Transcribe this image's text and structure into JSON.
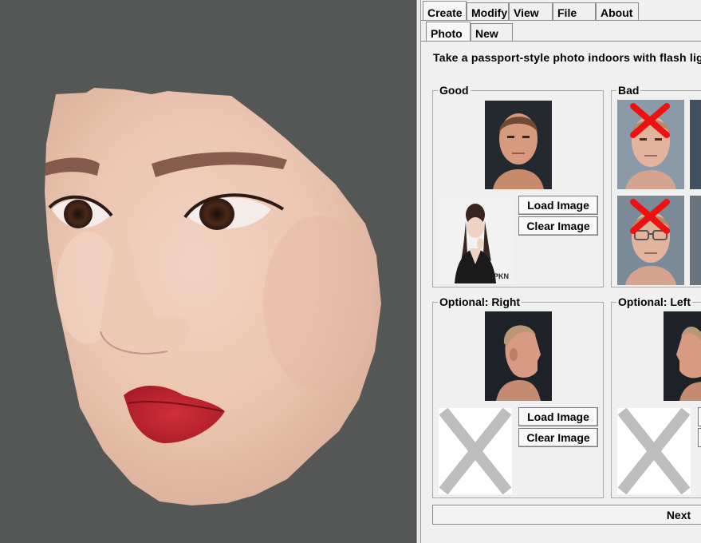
{
  "viewport": {
    "label": "3D face preview"
  },
  "tabs": {
    "main": [
      "Create",
      "Modify",
      "View",
      "File",
      "About"
    ],
    "sub": [
      "Photo",
      "New"
    ]
  },
  "instruction": "Take a passport-style photo indoors with flash lighti",
  "groups": {
    "good": "Good",
    "bad": "Bad",
    "optional_right": "Optional: Right",
    "optional_left": "Optional: Left"
  },
  "buttons": {
    "load_image": "Load Image",
    "clear_image": "Clear Image",
    "next": "Next"
  },
  "thumbnail_text": "IPKN",
  "colors": {
    "viewport_bg": "#555656",
    "panel_bg": "#f0f0f0",
    "bad_mark": "#ee1111",
    "placeholder_x": "#bdbdbd"
  }
}
